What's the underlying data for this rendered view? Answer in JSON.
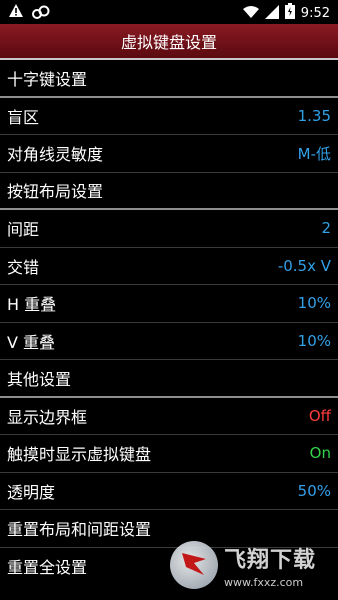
{
  "status_bar": {
    "time": "9:52"
  },
  "title": "虚拟键盘设置",
  "rows": [
    {
      "label": "十字键设置",
      "value": "",
      "type": "header"
    },
    {
      "label": "盲区",
      "value": "1.35",
      "type": "item",
      "color": "#33a0e8"
    },
    {
      "label": "对角线灵敏度",
      "value": "M-低",
      "type": "item",
      "color": "#33a0e8"
    },
    {
      "label": "按钮布局设置",
      "value": "",
      "type": "header"
    },
    {
      "label": "间距",
      "value": "2",
      "type": "item",
      "color": "#33a0e8"
    },
    {
      "label": "交错",
      "value": "-0.5x V",
      "type": "item",
      "color": "#33a0e8"
    },
    {
      "label": "H 重叠",
      "value": "10%",
      "type": "item",
      "color": "#33a0e8"
    },
    {
      "label": "V 重叠",
      "value": "10%",
      "type": "item",
      "color": "#33a0e8"
    },
    {
      "label": "其他设置",
      "value": "",
      "type": "header"
    },
    {
      "label": "显示边界框",
      "value": "Off",
      "type": "item",
      "color": "#ff3b3b"
    },
    {
      "label": "触摸时显示虚拟键盘",
      "value": "On",
      "type": "item",
      "color": "#34d44a"
    },
    {
      "label": "透明度",
      "value": "50%",
      "type": "item",
      "color": "#33a0e8"
    },
    {
      "label": "重置布局和间距设置",
      "value": "",
      "type": "item",
      "color": "#33a0e8"
    },
    {
      "label": "重置全设置",
      "value": "",
      "type": "item",
      "color": "#33a0e8"
    }
  ],
  "watermark": {
    "title": "飞翔下载",
    "url": "www.fxxz.com"
  },
  "icons": [
    "warning-triangle-icon",
    "cloud-icon",
    "wifi-icon",
    "signal-icon",
    "battery-icon"
  ]
}
